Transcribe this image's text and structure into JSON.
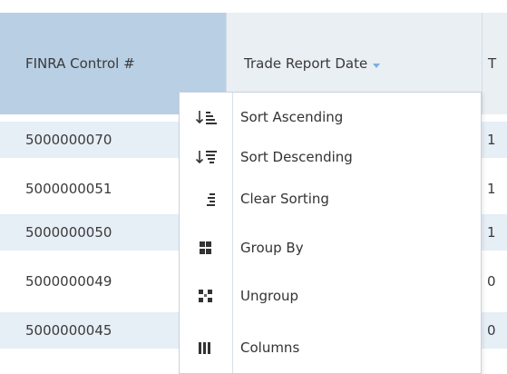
{
  "grid": {
    "columns": [
      {
        "label": "FINRA Control #"
      },
      {
        "label": "Trade Report Date"
      },
      {
        "label": "T"
      }
    ],
    "rows": [
      {
        "control": "5000000070",
        "third": "1"
      },
      {
        "control": "5000000051",
        "third": "1"
      },
      {
        "control": "5000000050",
        "third": "1"
      },
      {
        "control": "5000000049",
        "third": "0"
      },
      {
        "control": "5000000045",
        "third": "0"
      }
    ]
  },
  "menu": {
    "items": [
      {
        "label": "Sort Ascending",
        "icon": "sort-ascending-icon"
      },
      {
        "label": "Sort Descending",
        "icon": "sort-descending-icon"
      },
      {
        "label": "Clear Sorting",
        "icon": "clear-sorting-icon"
      },
      {
        "label": "Group By",
        "icon": "group-by-icon"
      },
      {
        "label": "Ungroup",
        "icon": "ungroup-icon"
      },
      {
        "label": "Columns",
        "icon": "columns-icon"
      }
    ]
  },
  "colors": {
    "header_bg": "#eaeff4",
    "selected_header_bg": "#b8cfe4",
    "alt_row_bg": "#e6eef6",
    "sort_arrow": "#7aaee0"
  }
}
